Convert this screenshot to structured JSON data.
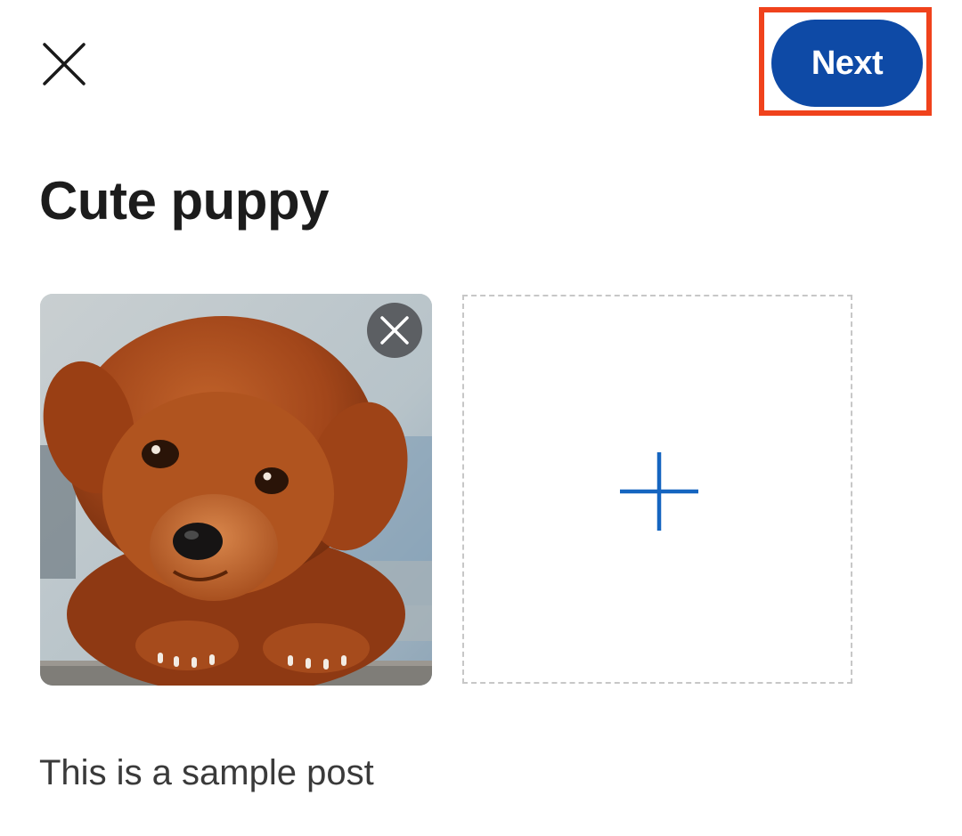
{
  "header": {
    "close_icon": "close-icon",
    "next_label": "Next",
    "next_color": "#0e4aa6",
    "highlight_color": "#f0421c"
  },
  "post": {
    "title": "Cute puppy",
    "body": "This is a sample post"
  },
  "media": {
    "photos": [
      {
        "subject": "puppy photo",
        "remove_icon": "remove-icon"
      }
    ],
    "add_icon": "plus-icon",
    "accent_color": "#1565c0"
  }
}
